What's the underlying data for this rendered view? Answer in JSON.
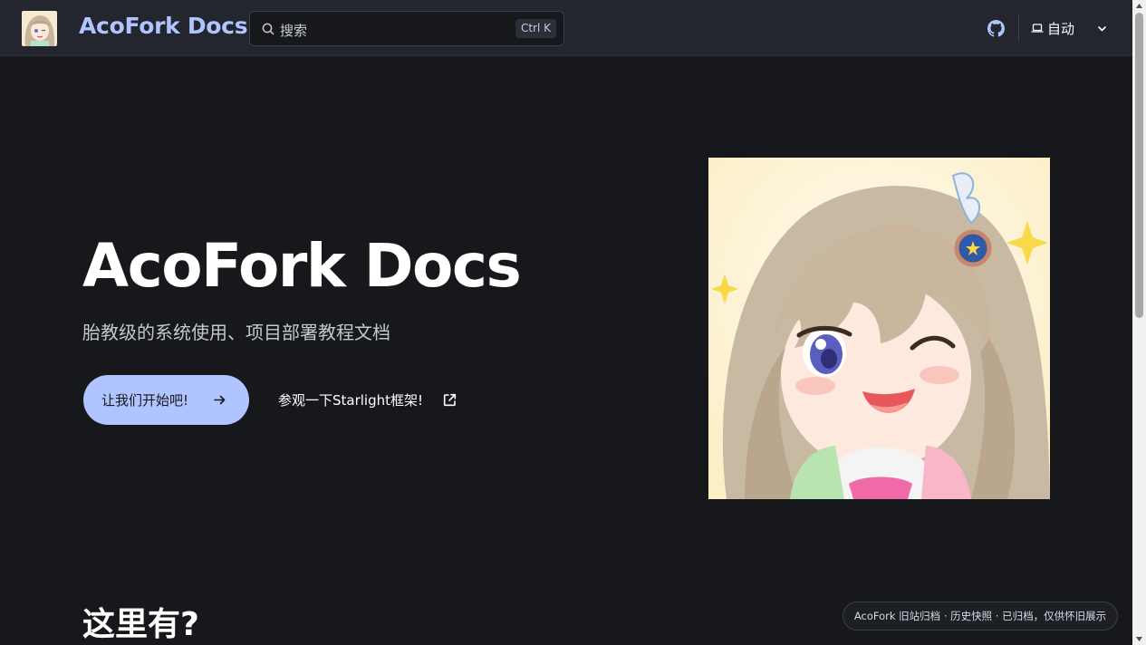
{
  "header": {
    "site_title": "AcoFork Docs",
    "search": {
      "placeholder": "搜索",
      "shortcut": "Ctrl K"
    },
    "theme": {
      "label": "自动"
    },
    "icons": [
      "search-icon",
      "github-icon",
      "laptop-icon",
      "chevron-down-icon"
    ]
  },
  "hero": {
    "title": "AcoFork Docs",
    "tagline": "胎教级的系统使用、项目部署教程文档",
    "primary_action": "让我们开始吧!",
    "secondary_action": "参观一下Starlight框架!"
  },
  "section": {
    "heading": "这里有?"
  },
  "archive_badge": "AcoFork 旧站归档 · 历史快照 · 已归档，仅供怀旧展示",
  "colors": {
    "accent": "#b0c4ff",
    "background": "#17181c",
    "header_bg": "#23252f"
  }
}
